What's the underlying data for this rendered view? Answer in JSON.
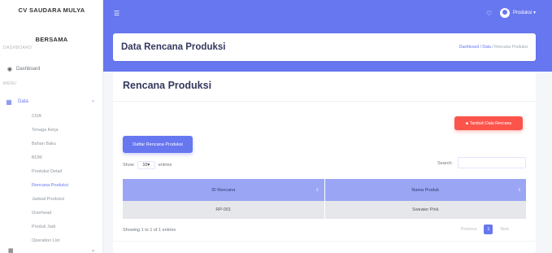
{
  "sidebar": {
    "brand_line1": "CV SAUDARA MULYA",
    "brand_line2": "BERSAMA",
    "sections": {
      "dashboard": "DASHBOARD",
      "menu": "MENU"
    },
    "dashboard_link": {
      "label": "Dashboard",
      "icon": "flame-icon"
    },
    "data_menu": {
      "label": "Data",
      "icon": "table-icon"
    },
    "submenu": [
      {
        "label": "COA"
      },
      {
        "label": "Tenaga Kerja"
      },
      {
        "label": "Bahan Baku"
      },
      {
        "label": "BOM"
      },
      {
        "label": "Produksi Detail"
      },
      {
        "label": "Rencana Produksi"
      },
      {
        "label": "Jadwal Produksi"
      },
      {
        "label": "Overhead"
      },
      {
        "label": "Produk Jadi"
      },
      {
        "label": "Operation List"
      }
    ]
  },
  "navbar": {
    "user_name": "Produksi",
    "accent_color": "#6777ef"
  },
  "header": {
    "title": "Data Rencana Produksi",
    "breadcrumbs": [
      "Dashboard",
      "Data",
      "Rencana Produksi"
    ]
  },
  "card": {
    "title": "Rencana Produksi",
    "add_button": "Tambah Data Rencana",
    "list_button": "Daftar Rencana Produksi",
    "show_label": "Show",
    "entries_value": "10",
    "entries_label": "entries",
    "search_label": "Search:",
    "columns": [
      "ID Rencana",
      "Nama Produk"
    ],
    "rows": [
      {
        "id": "RP-001",
        "name": "Sweater Pink"
      }
    ],
    "info": "Showing 1 to 1 of 1 entries",
    "pager": {
      "prev": "Previous",
      "current": "1",
      "next": "Next"
    }
  },
  "colors": {
    "danger": "#fc544b",
    "primary": "#6777ef",
    "table_header": "#9aa6f4"
  }
}
